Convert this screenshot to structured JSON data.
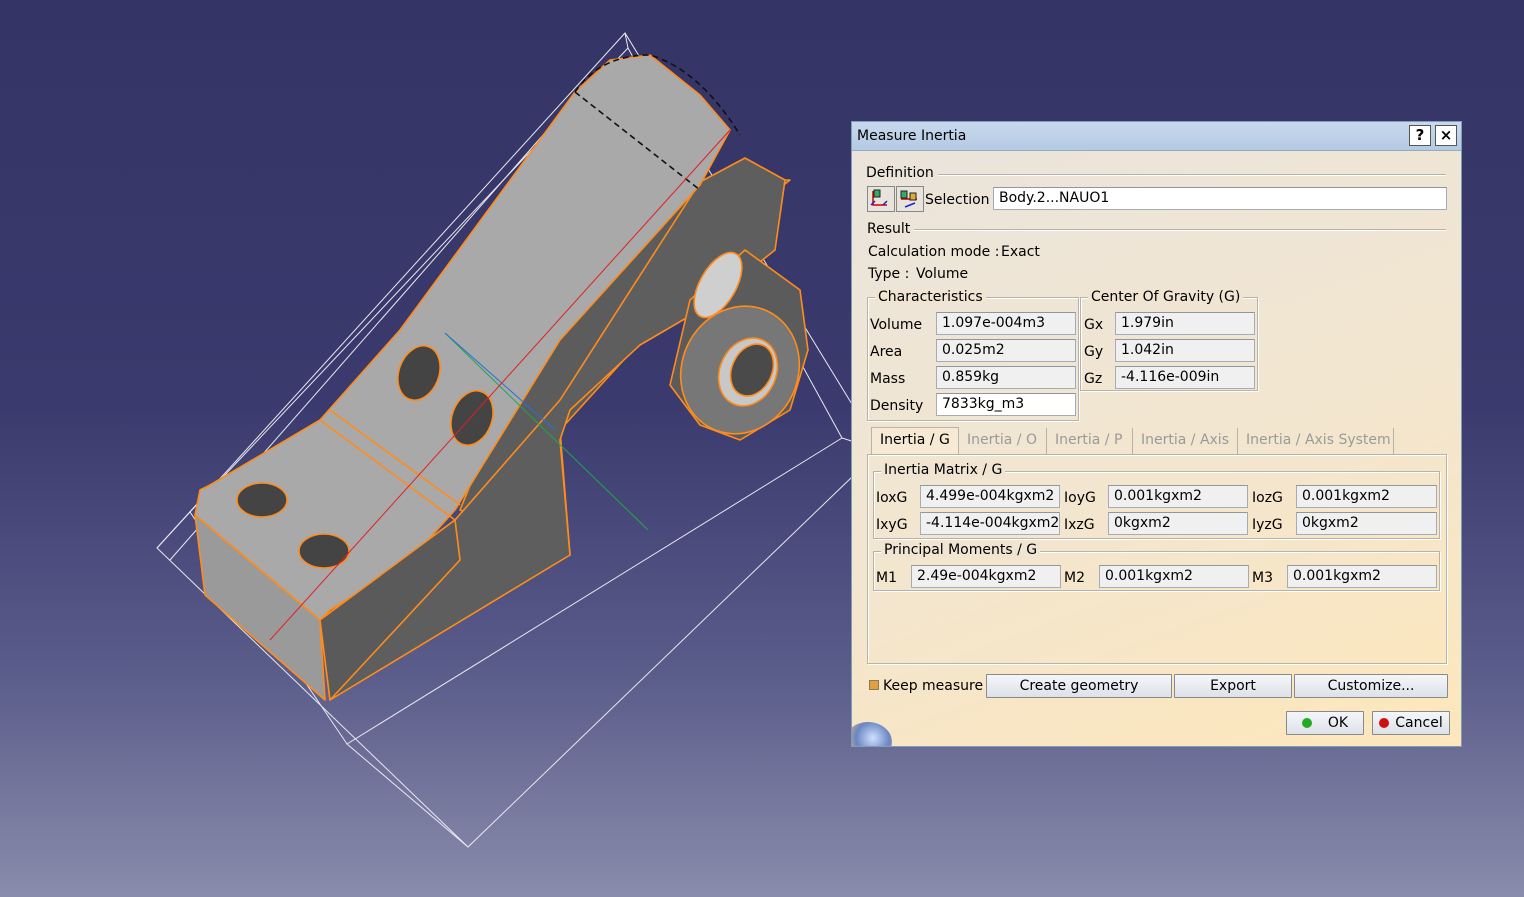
{
  "dialog": {
    "title": "Measure Inertia",
    "help_label": "?",
    "close_label": "×",
    "definition_label": "Definition",
    "selection_label": "Selection :",
    "selection_value": "Body.2...NAUO1",
    "result_label": "Result",
    "calc_mode_label": "Calculation mode :",
    "calc_mode_value": "Exact",
    "type_label": "Type :",
    "type_value": "Volume",
    "characteristics": {
      "label": "Characteristics",
      "rows": [
        {
          "name": "Volume",
          "value": "1.097e-004m3"
        },
        {
          "name": "Area",
          "value": "0.025m2"
        },
        {
          "name": "Mass",
          "value": "0.859kg"
        },
        {
          "name": "Density",
          "value": "7833kg_m3"
        }
      ]
    },
    "cog": {
      "label": "Center Of Gravity (G)",
      "rows": [
        {
          "name": "Gx",
          "value": "1.979in"
        },
        {
          "name": "Gy",
          "value": "1.042in"
        },
        {
          "name": "Gz",
          "value": "-4.116e-009in"
        }
      ]
    },
    "tabs": [
      "Inertia / G",
      "Inertia / O",
      "Inertia / P",
      "Inertia / Axis",
      "Inertia / Axis System"
    ],
    "active_tab": "Inertia / G",
    "matrix": {
      "label": "Inertia Matrix / G",
      "IoxG": {
        "label": "IoxG",
        "value": "4.499e-004kgxm2"
      },
      "IoyG": {
        "label": "IoyG",
        "value": "0.001kgxm2"
      },
      "IozG": {
        "label": "IozG",
        "value": "0.001kgxm2"
      },
      "IxyG": {
        "label": "IxyG",
        "value": "-4.114e-004kgxm2"
      },
      "IxzG": {
        "label": "IxzG",
        "value": "0kgxm2"
      },
      "IyzG": {
        "label": "IyzG",
        "value": "0kgxm2"
      }
    },
    "principal": {
      "label": "Principal Moments / G",
      "M1": {
        "label": "M1",
        "value": "2.49e-004kgxm2"
      },
      "M2": {
        "label": "M2",
        "value": "0.001kgxm2"
      },
      "M3": {
        "label": "M3",
        "value": "0.001kgxm2"
      }
    },
    "keep_measure_label": "Keep measure",
    "keep_measure_checked": true,
    "create_geometry_label": "Create geometry",
    "export_label": "Export",
    "customize_label": "Customize...",
    "ok_label": "OK",
    "cancel_label": "Cancel"
  },
  "colors": {
    "background_top": "#343466",
    "part_edge": "#ff8c1a",
    "part_face": "#a8a8a8",
    "ok_dot": "#22aa22",
    "cancel_dot": "#cc1111"
  }
}
